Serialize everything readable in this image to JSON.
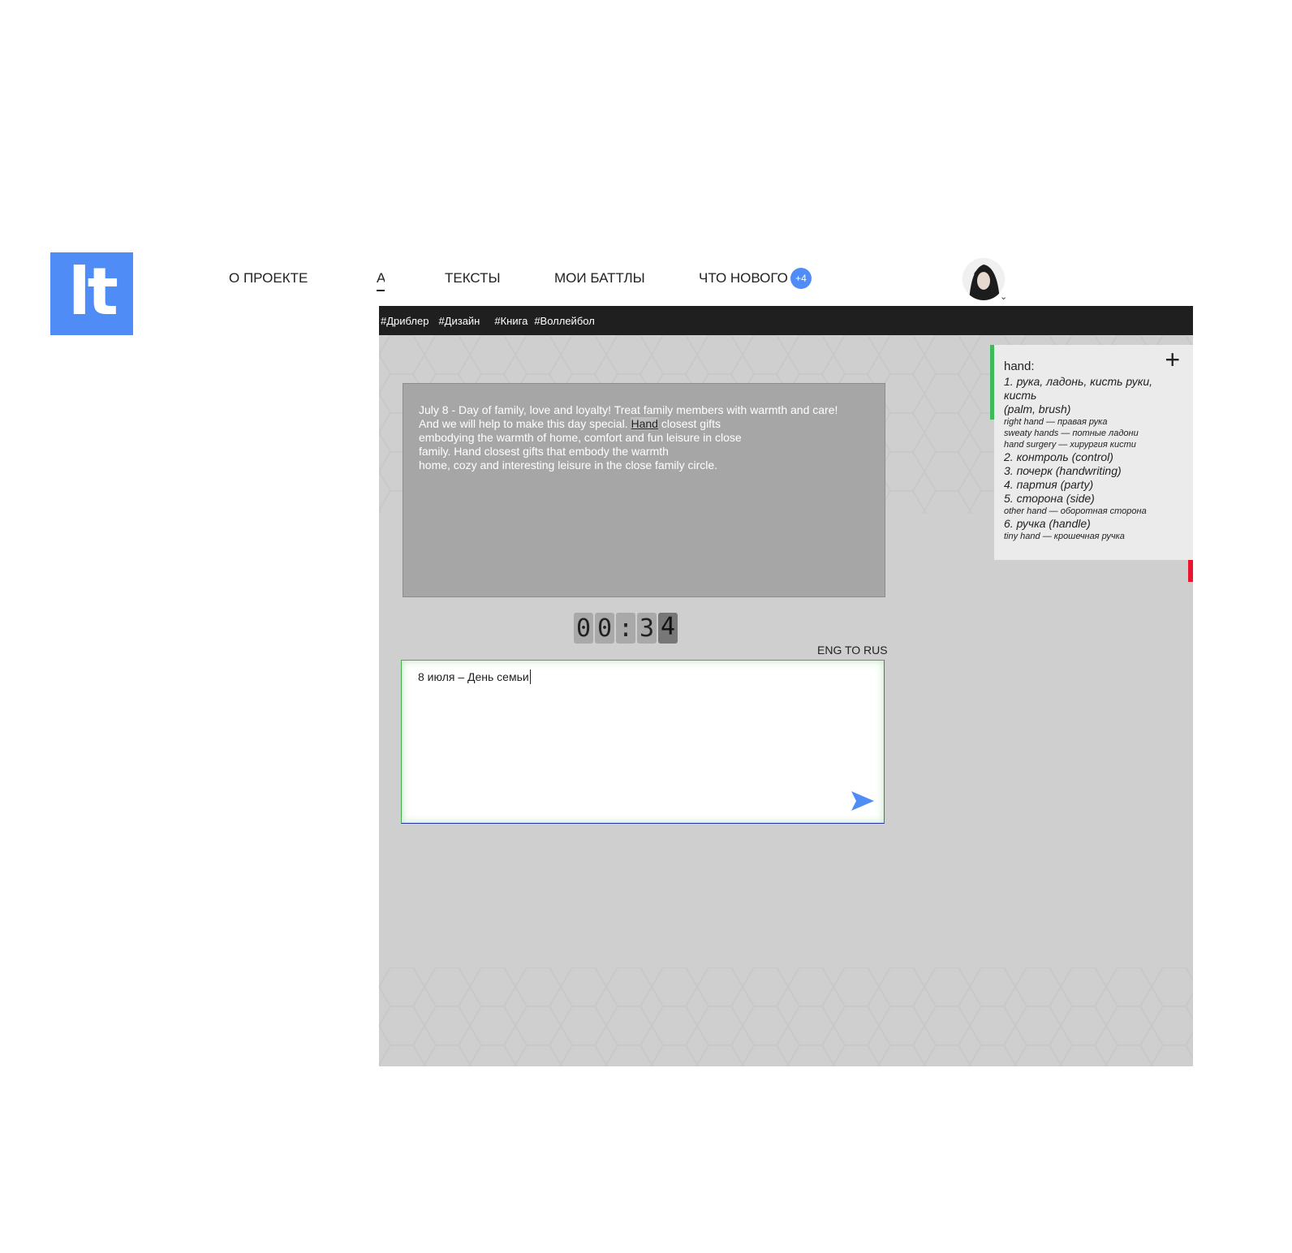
{
  "logo": {
    "text": "lt"
  },
  "nav": {
    "about": "О ПРОЕКТЕ",
    "partial": "А",
    "texts": "ТЕКСТЫ",
    "battles": "МОИ БАТТЛЫ",
    "news": "ЧТО НОВОГО",
    "news_badge": "+4"
  },
  "tags": [
    "#Дриблер",
    "#Дизайн",
    "#Книга",
    "#Воллейбол"
  ],
  "source": {
    "line1": "July 8 - Day of family, love and loyalty! Treat family members with warmth and care!",
    "line2_before": "And we will help to make this day special. ",
    "line2_highlight": "Hand",
    "line2_after": " closest gifts",
    "line3": "embodying the warmth of home, comfort and fun leisure in close",
    "line4": "family. Hand closest gifts that embody the warmth",
    "line5": "home, cozy and interesting leisure in the close family circle."
  },
  "timer": {
    "d1": "0",
    "d2": "0",
    "sep": ":",
    "d3": "3",
    "d4": "4"
  },
  "direction": "ENG TO RUS",
  "translation": {
    "value": "8 июля – День семьи"
  },
  "dictionary": {
    "word": "hand:",
    "plus": "+",
    "s1": "1. рука, ладонь, кисть руки, кисть",
    "s1b": "(palm, brush)",
    "e1": "right hand — правая рука",
    "e2": "sweaty hands — потные ладони",
    "e3": "hand surgery — хирургия кисти",
    "s2": "2. контроль (control)",
    "s3": "3. почерк (handwriting)",
    "s4": "4. партия (party)",
    "s5": "5. сторона (side)",
    "e5": "other hand — оборотная сторона",
    "s6": "6. ручка (handle)",
    "e6": "tiny hand — крошечная ручка"
  },
  "colors": {
    "accent": "#4f8cf5",
    "tagbar": "#1f1f1f",
    "stage": "#cfcfcf",
    "dict_green": "#3dbb5a",
    "dict_navy": "#232a5c",
    "dict_red": "#e8152c"
  },
  "icons": {
    "send": "send-arrow-icon",
    "add": "plus-icon",
    "avatar_menu": "chevron-down-icon"
  }
}
